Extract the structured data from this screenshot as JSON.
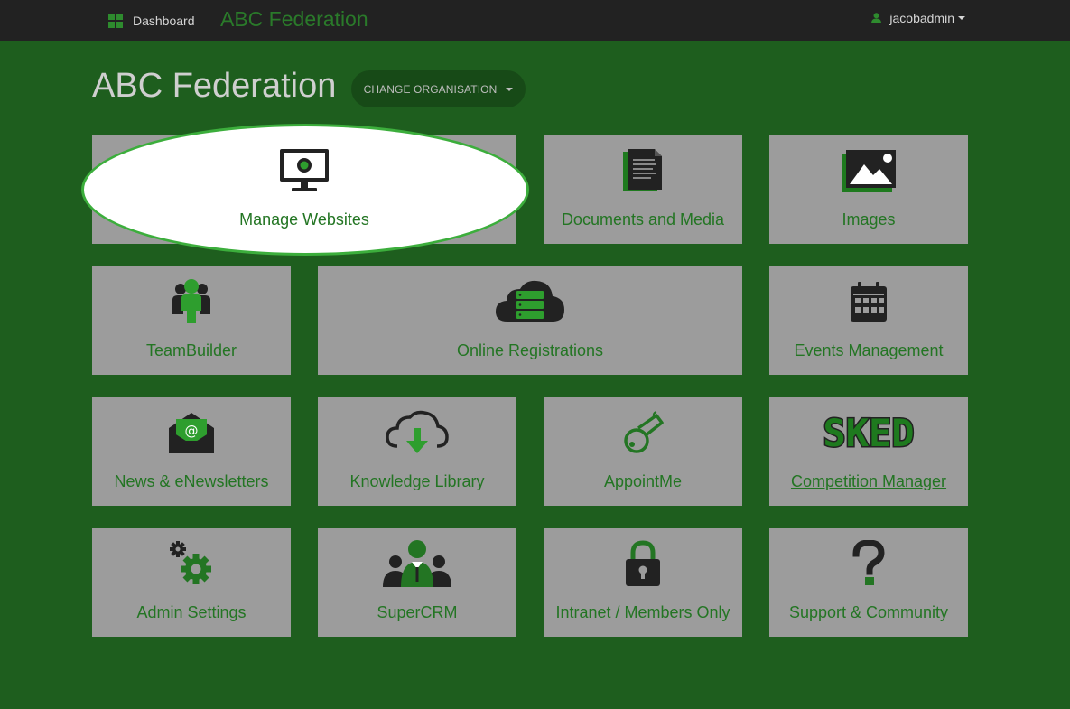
{
  "nav": {
    "dashboard_label": "Dashboard",
    "brand": "ABC Federation",
    "user": "jacobadmin"
  },
  "header": {
    "title": "ABC Federation",
    "change_org_label": "CHANGE ORGANISATION"
  },
  "tiles": [
    {
      "label": "Manage Websites",
      "icon": "monitor-icon"
    },
    {
      "label": "Documents and Media",
      "icon": "document-icon"
    },
    {
      "label": "Images",
      "icon": "image-icon"
    },
    {
      "label": "TeamBuilder",
      "icon": "team-icon"
    },
    {
      "label": "Online Registrations",
      "icon": "cloud-server-icon"
    },
    {
      "label": "Events Management",
      "icon": "calendar-icon"
    },
    {
      "label": "News & eNewsletters",
      "icon": "envelope-icon"
    },
    {
      "label": "Knowledge Library",
      "icon": "cloud-download-icon"
    },
    {
      "label": "AppointMe",
      "icon": "whistle-icon"
    },
    {
      "label": "Competition Manager",
      "icon": "sked-logo",
      "logo_text": "SKED"
    },
    {
      "label": "Admin Settings",
      "icon": "gears-icon"
    },
    {
      "label": "SuperCRM",
      "icon": "people-icon"
    },
    {
      "label": "Intranet / Members Only",
      "icon": "lock-icon"
    },
    {
      "label": "Support & Community",
      "icon": "question-icon"
    }
  ],
  "colors": {
    "background": "#1e5e1e",
    "topbar": "#222222",
    "tile": "#9c9c9c",
    "accent": "#237523",
    "highlight": "#ffffff"
  }
}
